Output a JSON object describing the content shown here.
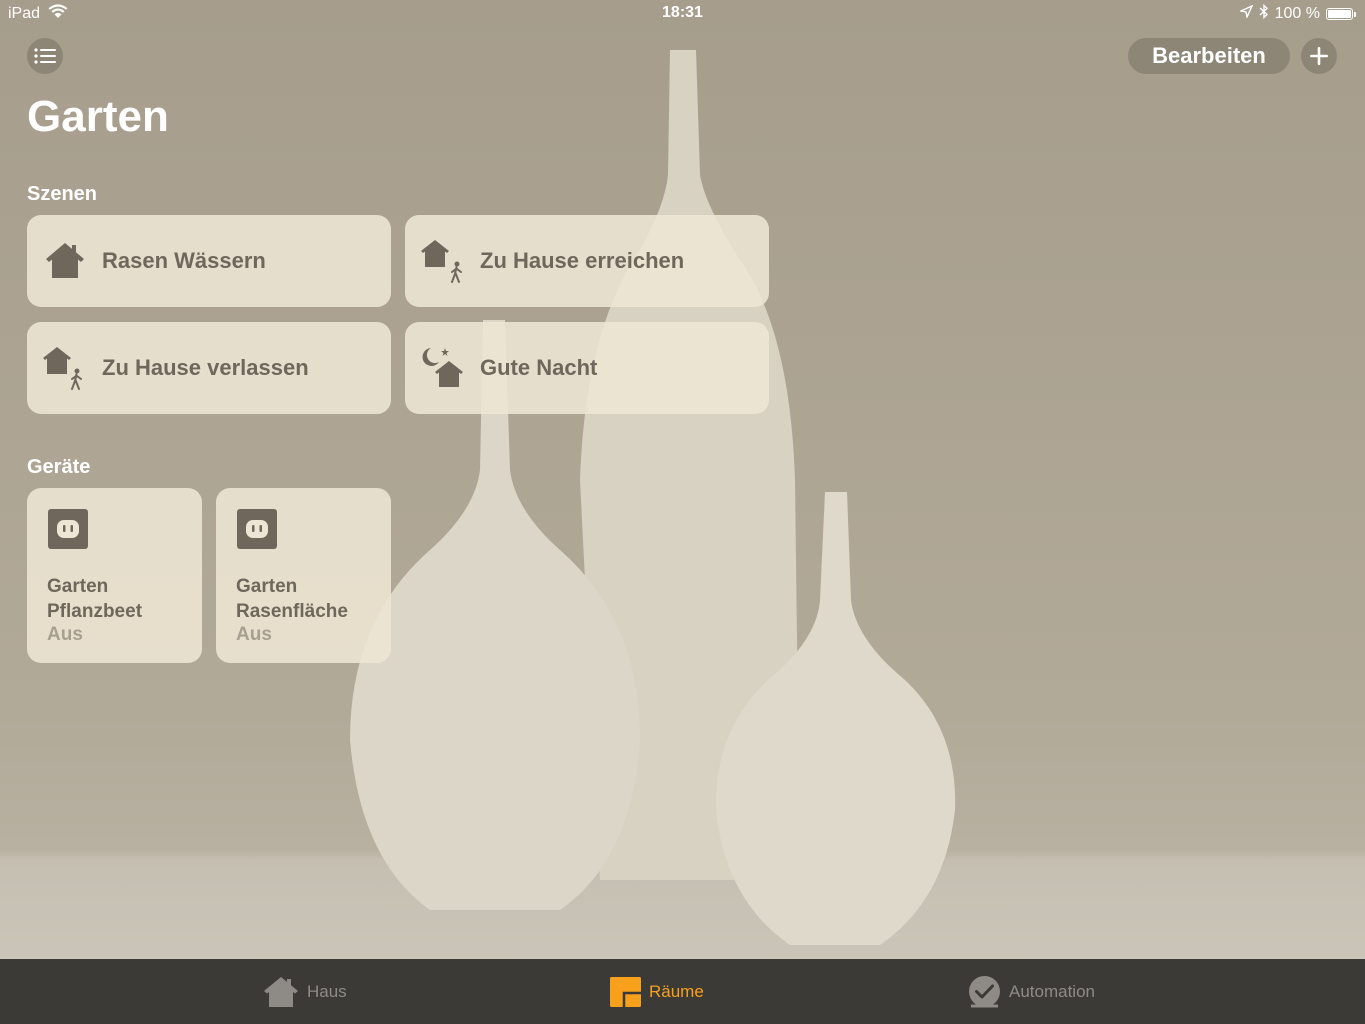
{
  "status_bar": {
    "device": "iPad",
    "time": "18:31",
    "battery": "100 %",
    "battery_level": 1.0
  },
  "header": {
    "title": "Garten",
    "edit_label": "Bearbeiten",
    "menu_icon": "list-icon",
    "add_icon": "plus-icon"
  },
  "scenes": {
    "label": "Szenen",
    "items": [
      {
        "label": "Rasen Wässern",
        "icon": "house-icon"
      },
      {
        "label": "Zu Hause erreichen",
        "icon": "arrive-home-icon"
      },
      {
        "label": "Zu Hause verlassen",
        "icon": "leave-home-icon"
      },
      {
        "label": "Gute Nacht",
        "icon": "good-night-icon"
      }
    ]
  },
  "devices": {
    "label": "Geräte",
    "items": [
      {
        "line1": "Garten",
        "line2": "Pflanzbeet",
        "status": "Aus",
        "icon": "outlet-icon"
      },
      {
        "line1": "Garten",
        "line2": "Rasenfläche",
        "status": "Aus",
        "icon": "outlet-icon"
      }
    ]
  },
  "tab_bar": {
    "tabs": [
      {
        "label": "Haus",
        "icon": "home-tab-icon",
        "active": false
      },
      {
        "label": "Räume",
        "icon": "rooms-tab-icon",
        "active": true
      },
      {
        "label": "Automation",
        "icon": "automation-tab-icon",
        "active": false
      }
    ],
    "active_color": "#f7a01c",
    "inactive_color": "#8e8b86"
  }
}
